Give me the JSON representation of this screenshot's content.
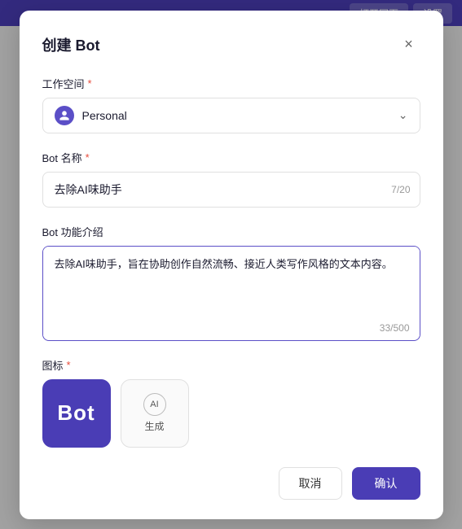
{
  "topbar": {
    "btn1": "打开网页",
    "btn2": "设置"
  },
  "modal": {
    "title": "创建 Bot",
    "close_label": "×",
    "workspace": {
      "label": "工作空间",
      "required": true,
      "value": "Personal",
      "icon": "person-icon"
    },
    "bot_name": {
      "label": "Bot 名称",
      "required": true,
      "value": "去除AI味助手",
      "char_current": 7,
      "char_max": 20,
      "char_display": "7/20"
    },
    "bot_desc": {
      "label": "Bot 功能介绍",
      "required": false,
      "value": "去除AI味助手，旨在协助创作自然流畅、接近人类写作风格的文本内容。",
      "char_current": 33,
      "char_max": 500,
      "char_display": "33/500"
    },
    "icon_section": {
      "label": "图标",
      "required": true,
      "preview_text": "Bot",
      "generate_label": "生成",
      "ai_label": "AI"
    },
    "footer": {
      "cancel_label": "取消",
      "confirm_label": "确认"
    }
  }
}
